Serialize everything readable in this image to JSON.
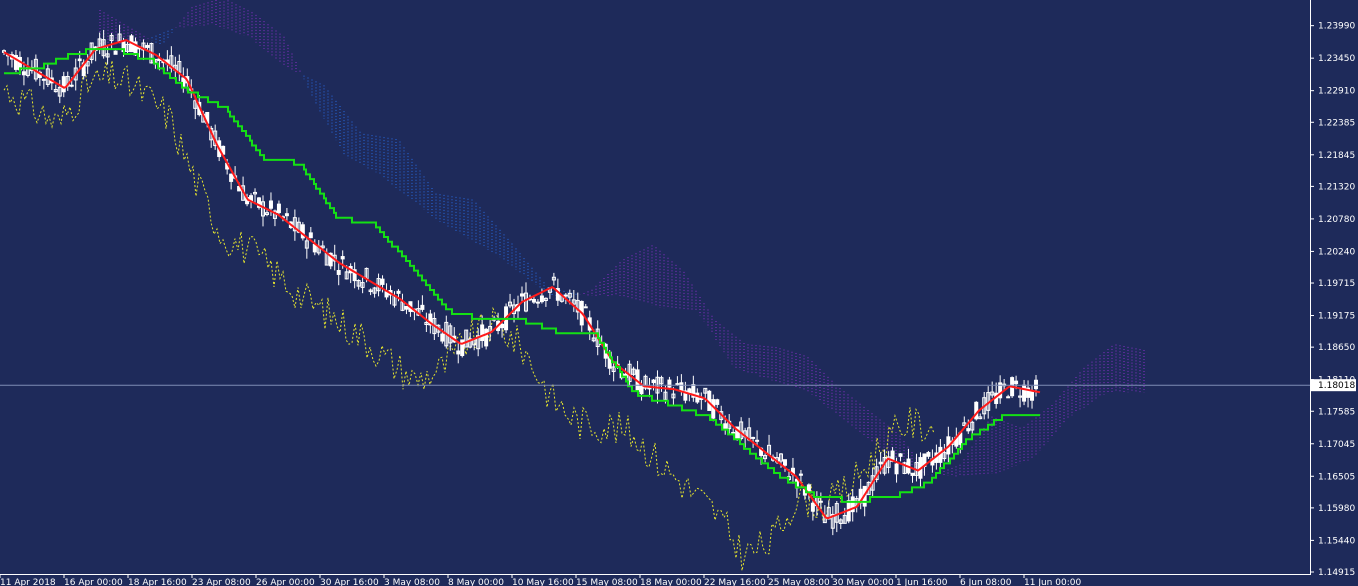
{
  "colors": {
    "background": "#1e2a5a",
    "candle": "#ffffff",
    "tenkan": "#ff1a1a",
    "kijun": "#14e014",
    "chikou": "#e6e62e",
    "cloud_bull": "#2a78ff",
    "cloud_bear": "#a030e0",
    "axis": "#ffffff",
    "price_line": "#7f8cb5"
  },
  "chart_data": {
    "type": "candlestick",
    "indicator": "ichimoku",
    "ylim": [
      1.14915,
      1.2425
    ],
    "y_ticks": [
      "1.23990",
      "1.23450",
      "1.22910",
      "1.22385",
      "1.21845",
      "1.21320",
      "1.20780",
      "1.20240",
      "1.19715",
      "1.19175",
      "1.18650",
      "1.18110",
      "1.17585",
      "1.17045",
      "1.16505",
      "1.15980",
      "1.15440",
      "1.14915"
    ],
    "x_labels": [
      "11 Apr 2018",
      "16 Apr 00:00",
      "18 Apr 16:00",
      "23 Apr 08:00",
      "26 Apr 00:00",
      "30 Apr 16:00",
      "3 May 08:00",
      "8 May 00:00",
      "10 May 16:00",
      "15 May 08:00",
      "18 May 00:00",
      "22 May 16:00",
      "25 May 08:00",
      "30 May 00:00",
      "1 Jun 16:00",
      "6 Jun 08:00",
      "11 Jun 00:00"
    ],
    "current_price": "1.18018",
    "tenkan_anchors": [
      [
        1.2355,
        1.2325,
        1.2295,
        1.236,
        1.2375,
        1.235,
        1.231,
        1.22,
        1.211,
        1.2085,
        1.2045,
        1.2005,
        1.1975,
        1.1945,
        1.1905,
        1.187,
        1.189,
        1.194,
        1.1965,
        1.192,
        1.184,
        1.18,
        1.1795,
        1.178,
        1.173,
        1.169,
        1.165,
        1.158,
        1.16,
        1.168,
        1.166,
        1.17,
        1.176,
        1.18,
        1.179
      ]
    ],
    "kijun_anchors": [
      [
        1.232,
        1.233,
        1.2355,
        1.236,
        1.234,
        1.229,
        1.226,
        1.218,
        1.217,
        1.208,
        1.207,
        1.2,
        1.1925,
        1.191,
        1.191,
        1.189,
        1.1885,
        1.179,
        1.177,
        1.175,
        1.17,
        1.165,
        1.1615,
        1.161,
        1.1615,
        1.164,
        1.171,
        1.175,
        1.175
      ]
    ]
  }
}
